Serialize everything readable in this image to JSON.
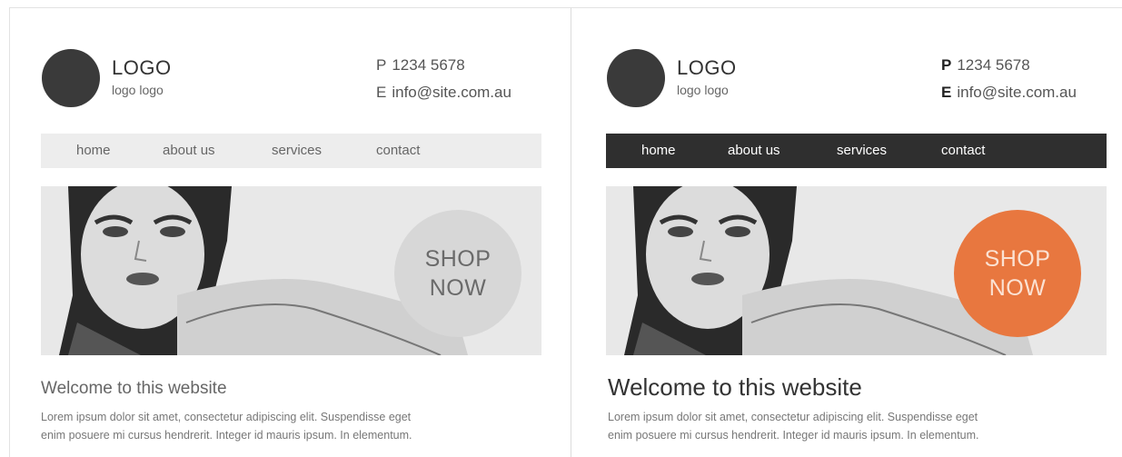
{
  "versions": [
    {
      "logo": {
        "title": "LOGO",
        "subtitle": "logo logo"
      },
      "contact": {
        "phone_label": "P",
        "phone": "1234 5678",
        "email_label": "E",
        "email": "info@site.com.au"
      },
      "nav": {
        "items": [
          "home",
          "about us",
          "services",
          "contact"
        ],
        "background": "#ededed"
      },
      "hero": {
        "cta_line1": "SHOP",
        "cta_line2": "NOW",
        "cta_color": "#d7d7d7"
      },
      "welcome": "Welcome to this website",
      "body": [
        "Lorem ipsum dolor sit amet, consectetur adipiscing elit. Suspendisse eget",
        "enim posuere mi cursus hendrerit. Integer id mauris ipsum. In elementum."
      ]
    },
    {
      "logo": {
        "title": "LOGO",
        "subtitle": "logo logo"
      },
      "contact": {
        "phone_label": "P",
        "phone": "1234 5678",
        "email_label": "E",
        "email": "info@site.com.au"
      },
      "nav": {
        "items": [
          "home",
          "about us",
          "services",
          "contact"
        ],
        "background": "#2f2f2f"
      },
      "hero": {
        "cta_line1": "SHOP",
        "cta_line2": "NOW",
        "cta_color": "#e8773f"
      },
      "welcome": "Welcome to this website",
      "body": [
        "Lorem ipsum dolor sit amet, consectetur adipiscing elit. Suspendisse eget",
        "enim posuere mi cursus hendrerit. Integer id mauris ipsum. In elementum."
      ]
    }
  ]
}
